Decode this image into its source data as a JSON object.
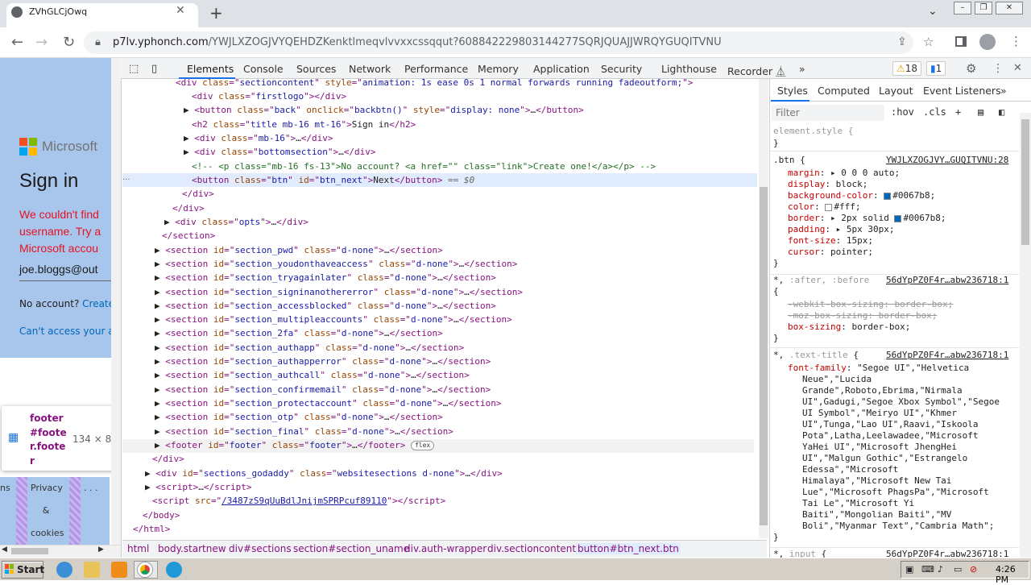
{
  "browser": {
    "tab_title": "ZVhGLCjOwq",
    "url_host": "p7lv.yphonch.com",
    "url_rest": "/YWJLXZOGJVYQEHDZKenktlmeqvlvvxxcssqqut?608842229803144277SQRJQUAJJWRQYGUQITVNU"
  },
  "page": {
    "ms_name": "Microsoft",
    "signin": "Sign in",
    "error_lines": [
      "We couldn't find",
      "username. Try a",
      "Microsoft accou"
    ],
    "email": "joe.bloggs@out",
    "no_account": "No account?",
    "create": "Create",
    "cant_access": "Can't access your a",
    "footer_partial": "ns",
    "footer_privacy": "Privacy",
    "footer_amp": "&",
    "footer_cookies": "cookies",
    "footer_dots": ". . ."
  },
  "tooltip": {
    "text": "footer#footer.footer",
    "size": "134 × 84"
  },
  "devtools": {
    "tabs": [
      "Elements",
      "Console",
      "Sources",
      "Network",
      "Performance",
      "Memory",
      "Application",
      "Security",
      "Lighthouse",
      "Recorder ⏅"
    ],
    "more": "»",
    "warnings": "18",
    "messages": "1"
  },
  "styles_panel": {
    "tabs": [
      "Styles",
      "Computed",
      "Layout",
      "Event Listeners"
    ],
    "more": "»",
    "filter": "Filter",
    "hov": ":hov",
    ".cls": ".cls"
  },
  "breadcrumbs": [
    "html",
    "body.startnew",
    "div#sections",
    "section#section_uname",
    "div.auth-wrapper",
    "div.sectioncontent",
    "button#btn_next.btn"
  ],
  "taskbar": {
    "start": "Start",
    "time": "4:26 PM"
  },
  "colors": {
    "ms_red": "#f25022",
    "ms_green": "#7fba00",
    "ms_blue": "#00a4ef",
    "ms_yellow": "#ffb900",
    "accent": "#0067b8"
  }
}
